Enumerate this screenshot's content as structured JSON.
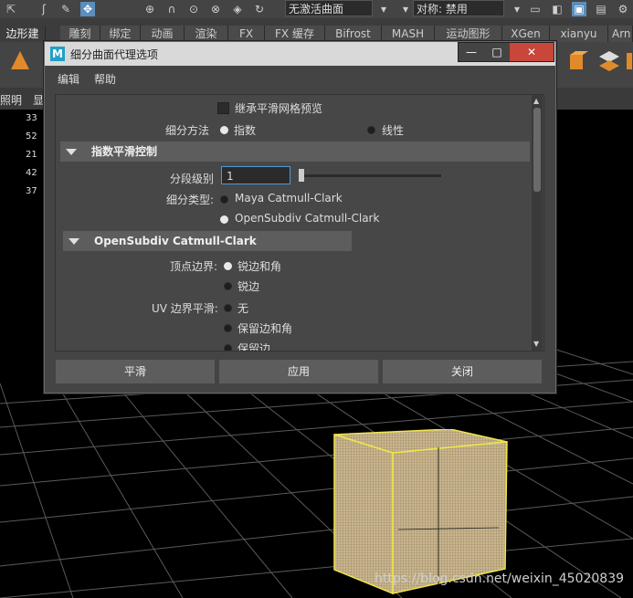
{
  "toolbar": {
    "combo_surface": "无激活曲面",
    "symmetry_label": "对称: 禁用"
  },
  "shelf": {
    "left_label": "边形建模",
    "tabs": [
      "雕刻",
      "绑定",
      "动画",
      "渲染",
      "FX",
      "FX 缓存",
      "Bifrost",
      "MASH",
      "运动图形",
      "XGen",
      "xianyu",
      "Arn"
    ]
  },
  "menu_strip": {
    "items": [
      "照明",
      "显"
    ]
  },
  "hud": {
    "values": [
      "33",
      "52",
      "21",
      "42",
      "37"
    ]
  },
  "dialog": {
    "title": "细分曲面代理选项",
    "app_badge": "M",
    "menu": [
      "编辑",
      "帮助"
    ],
    "inherit_checkbox": {
      "label": "继承平滑网格预览",
      "checked": false
    },
    "method": {
      "label": "细分方法",
      "options": [
        "指数",
        "线性"
      ],
      "selected": 0
    },
    "section_exponential": {
      "title": "指数平滑控制"
    },
    "division_level": {
      "label": "分段级别",
      "value": "1",
      "slider_fraction": 0.0
    },
    "subdiv_type": {
      "label": "细分类型:",
      "options": [
        "Maya Catmull-Clark",
        "OpenSubdiv Catmull-Clark"
      ],
      "selected": 1
    },
    "section_osd": {
      "title": "OpenSubdiv Catmull-Clark"
    },
    "vertex_boundary": {
      "label": "顶点边界:",
      "options": [
        "锐边和角",
        "锐边"
      ],
      "selected": 0
    },
    "uv_boundary": {
      "label": "UV 边界平滑:",
      "options": [
        "无",
        "保留边和角",
        "保留边"
      ],
      "selected": 0
    },
    "buttons": {
      "smooth": "平滑",
      "apply": "应用",
      "close": "关闭"
    }
  },
  "watermark": "https://blog.csdn.net/weixin_45020839",
  "colors": {
    "accent_blue": "#4a9ad8",
    "cube_edge": "#f0e64a",
    "cube_fill": "#d9c7a0"
  }
}
